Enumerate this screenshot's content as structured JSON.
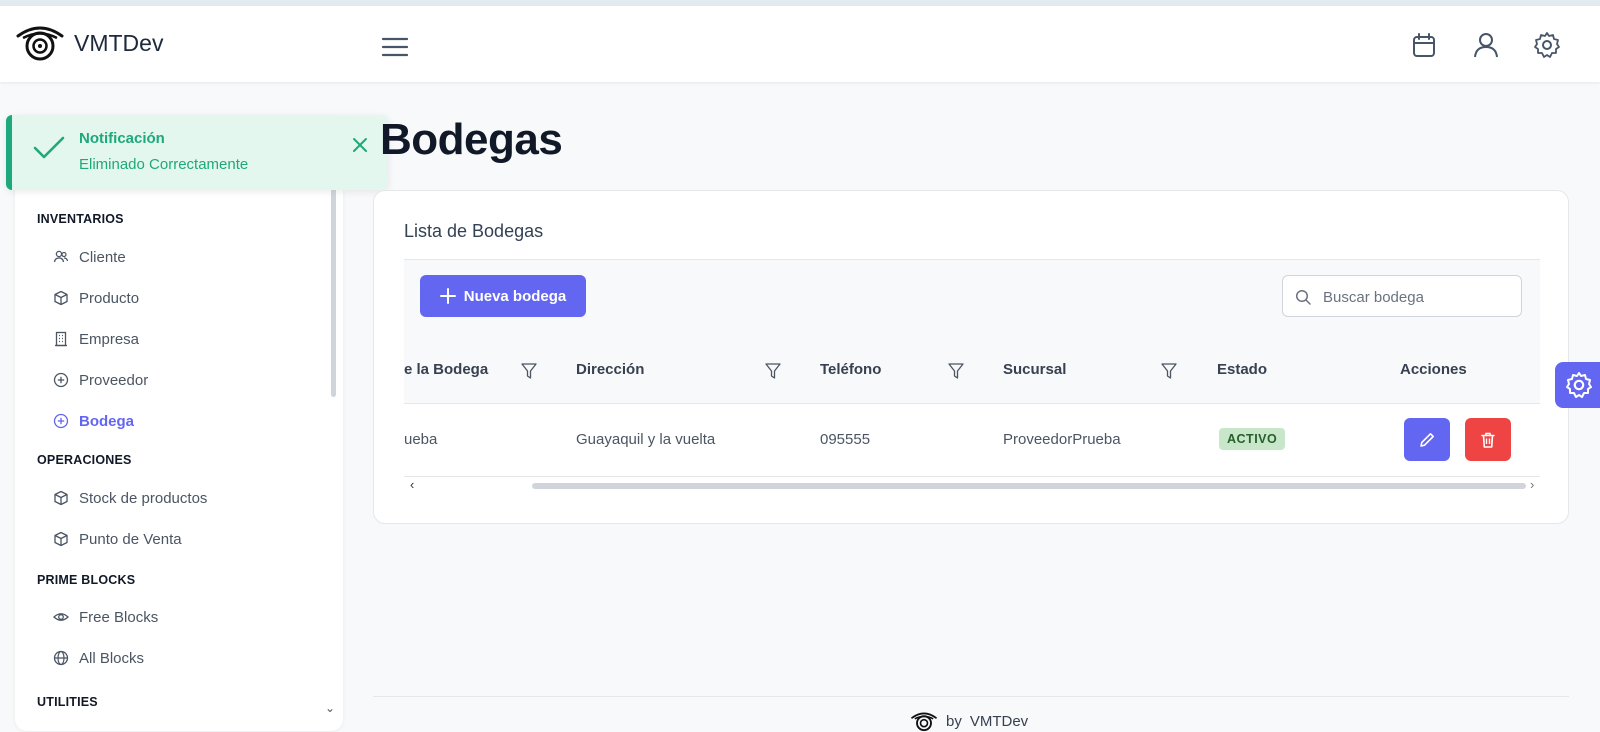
{
  "app": {
    "brand": "VMTDev"
  },
  "toast": {
    "title": "Notificación",
    "message": "Eliminado Correctamente"
  },
  "sidebar": {
    "sections": [
      {
        "title": "INVENTARIOS",
        "items": [
          {
            "label": "Cliente",
            "icon": "users-icon"
          },
          {
            "label": "Producto",
            "icon": "box-icon"
          },
          {
            "label": "Empresa",
            "icon": "building-icon"
          },
          {
            "label": "Proveedor",
            "icon": "plus-circle-icon"
          },
          {
            "label": "Bodega",
            "icon": "plus-circle-icon",
            "active": true
          }
        ]
      },
      {
        "title": "OPERACIONES",
        "items": [
          {
            "label": "Stock de productos",
            "icon": "box-icon"
          },
          {
            "label": "Punto de Venta",
            "icon": "box-icon"
          }
        ]
      },
      {
        "title": "PRIME BLOCKS",
        "items": [
          {
            "label": "Free Blocks",
            "icon": "eye-icon"
          },
          {
            "label": "All Blocks",
            "icon": "globe-icon"
          }
        ]
      },
      {
        "title": "UTILITIES",
        "items": []
      }
    ]
  },
  "page": {
    "title": "Bodegas"
  },
  "card": {
    "title": "Lista de Bodegas",
    "new_button": "Nueva bodega",
    "search_placeholder": "Buscar bodega"
  },
  "table": {
    "columns": [
      "e la Bodega",
      "Dirección",
      "Teléfono",
      "Sucursal",
      "Estado",
      "Acciones"
    ],
    "rows": [
      {
        "nombre": "ueba",
        "direccion": "Guayaquil y la vuelta",
        "telefono": "095555",
        "sucursal": "ProveedorPrueba",
        "estado": "ACTIVO"
      }
    ]
  },
  "footer": {
    "by": "by",
    "brand": "VMTDev"
  },
  "colors": {
    "primary": "#6366f1",
    "success": "#1ea97c",
    "danger": "#ef4444"
  }
}
